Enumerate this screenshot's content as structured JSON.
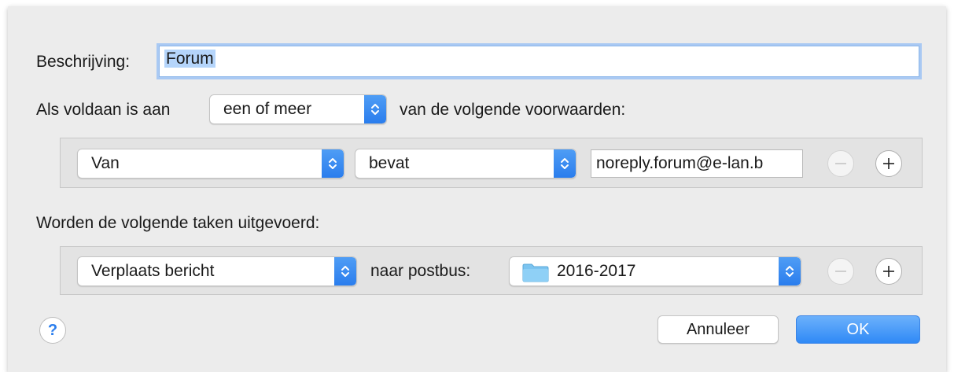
{
  "description": {
    "label": "Beschrijving:",
    "value": "Forum"
  },
  "condition": {
    "prefix": "Als voldaan is aan",
    "match_mode": "een of meer",
    "suffix": "van de volgende voorwaarden:"
  },
  "rules": [
    {
      "field": "Van",
      "operator": "bevat",
      "value": "noreply.forum@e-lan.b"
    }
  ],
  "actions_heading": "Worden de volgende taken uitgevoerd:",
  "actions": [
    {
      "action": "Verplaats bericht",
      "target_label": "naar postbus:",
      "mailbox": "2016-2017"
    }
  ],
  "buttons": {
    "help": "?",
    "cancel": "Annuleer",
    "ok": "OK"
  },
  "icons": {
    "popup_arrows": "up-down-chevron-icon",
    "remove": "minus-icon",
    "add": "plus-icon",
    "mailbox": "folder-icon"
  },
  "colors": {
    "accent": "#2a7ded",
    "folder": "#7cc4f0"
  }
}
